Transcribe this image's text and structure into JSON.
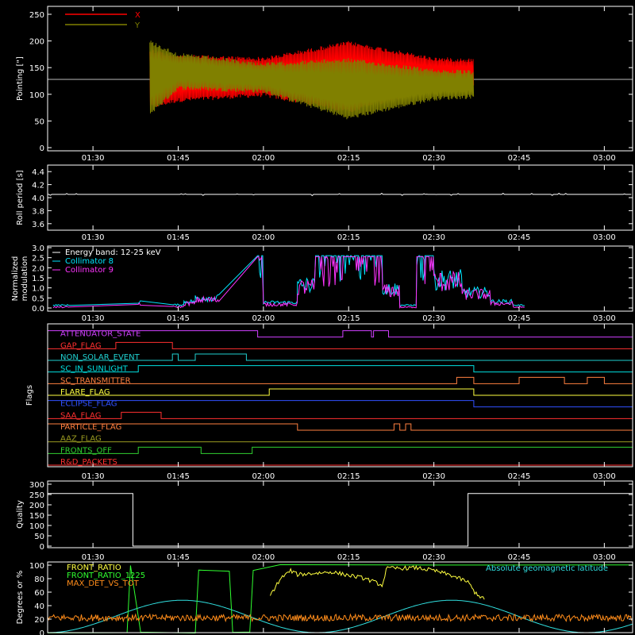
{
  "chart_data": [
    {
      "id": "pointing",
      "type": "line",
      "ylabel": "Pointing [\"]",
      "ylim": [
        0,
        250
      ],
      "yticks": [
        "0",
        "50",
        "100",
        "150",
        "200",
        "250"
      ],
      "reference_line": 128,
      "series": [
        {
          "name": "X",
          "color": "#ff0000",
          "envelope": [
            [
              1.667,
              72,
              185
            ],
            [
              1.75,
              85,
              175
            ],
            [
              2.0,
              95,
              170
            ],
            [
              2.25,
              65,
              200
            ],
            [
              2.5,
              108,
              170
            ],
            [
              2.617,
              112,
              168
            ]
          ]
        },
        {
          "name": "Y",
          "color": "#808000",
          "envelope": [
            [
              1.667,
              60,
              202
            ],
            [
              1.75,
              108,
              178
            ],
            [
              2.0,
              102,
              160
            ],
            [
              2.25,
              52,
              168
            ],
            [
              2.5,
              88,
              148
            ],
            [
              2.617,
              92,
              145
            ]
          ]
        }
      ]
    },
    {
      "id": "roll",
      "type": "line",
      "ylabel": "Roll period [s]",
      "ylim": [
        3.5,
        4.5
      ],
      "yticks": [
        "3.6",
        "3.8",
        "4.0",
        "4.2",
        "4.4"
      ],
      "series": [
        {
          "name": "",
          "color": "#ffffff",
          "value": 4.05,
          "x": [
            1.367,
            3.083
          ]
        }
      ]
    },
    {
      "id": "modulation",
      "type": "line",
      "ylabel_lines": [
        "Normalized",
        "modulation"
      ],
      "ylim": [
        0,
        3
      ],
      "yticks": [
        "0.0",
        "0.5",
        "1.0",
        "1.5",
        "2.0",
        "2.5",
        "3.0"
      ],
      "legend": [
        "Energy band: 12-25 keV",
        "Collimator 8",
        "Collimator 9"
      ],
      "series": [
        {
          "name": "Collimator 8",
          "color": "#00e5ff"
        },
        {
          "name": "Collimator 9",
          "color": "#ff33ff"
        }
      ],
      "segments": [
        [
          1.383,
          1.433,
          0.1
        ],
        [
          1.633,
          1.64,
          0.3
        ],
        [
          1.733,
          1.767,
          0.12
        ],
        [
          1.767,
          1.8,
          0.3
        ],
        [
          1.8,
          1.87,
          0.5
        ],
        [
          1.983,
          2.0,
          2.6
        ],
        [
          2.0,
          2.1,
          0.25
        ],
        [
          2.1,
          2.15,
          1.2
        ],
        [
          2.15,
          2.35,
          2.6
        ],
        [
          2.35,
          2.4,
          1.0
        ],
        [
          2.4,
          2.45,
          0.1
        ],
        [
          2.45,
          2.5,
          2.6
        ],
        [
          2.5,
          2.583,
          1.5
        ],
        [
          2.583,
          2.667,
          0.8
        ],
        [
          2.667,
          2.733,
          0.3
        ],
        [
          2.733,
          2.767,
          0.1
        ]
      ]
    },
    {
      "id": "flags",
      "type": "table",
      "ylabel": "Flags",
      "rows": [
        {
          "label": "ATTENUATOR_STATE",
          "color": "#d040ff",
          "transitions": [
            [
              1.367,
              1
            ],
            [
              1.983,
              0
            ],
            [
              2.233,
              1
            ],
            [
              2.317,
              0
            ],
            [
              2.323,
              1
            ],
            [
              2.367,
              0
            ],
            [
              3.083,
              0
            ]
          ]
        },
        {
          "label": "GAP_FLAG",
          "color": "#ff3030",
          "transitions": [
            [
              1.367,
              0
            ],
            [
              1.567,
              1
            ],
            [
              1.733,
              0
            ],
            [
              3.083,
              0
            ]
          ]
        },
        {
          "label": "NON_SOLAR_EVENT",
          "color": "#20d0d0",
          "transitions": [
            [
              1.367,
              0
            ],
            [
              1.733,
              1
            ],
            [
              1.75,
              0
            ],
            [
              1.8,
              1
            ],
            [
              1.95,
              0
            ],
            [
              3.083,
              0
            ]
          ]
        },
        {
          "label": "SC_IN_SUNLIGHT",
          "color": "#00e0e0",
          "transitions": [
            [
              1.367,
              0
            ],
            [
              1.633,
              1
            ],
            [
              2.617,
              0
            ],
            [
              3.083,
              0
            ]
          ]
        },
        {
          "label": "SC_TRANSMITTER",
          "color": "#ff8040",
          "transitions": [
            [
              1.367,
              0
            ],
            [
              2.567,
              1
            ],
            [
              2.617,
              0
            ],
            [
              2.75,
              1
            ],
            [
              2.883,
              0
            ],
            [
              2.95,
              1
            ],
            [
              3.0,
              0
            ],
            [
              3.083,
              0
            ]
          ]
        },
        {
          "label": "FLARE_FLAG",
          "color": "#ffff40",
          "transitions": [
            [
              1.367,
              0
            ],
            [
              2.017,
              1
            ],
            [
              2.617,
              0
            ],
            [
              3.083,
              0
            ]
          ]
        },
        {
          "label": "ECLIPSE_FLAG",
          "color": "#3050ff",
          "transitions": [
            [
              1.367,
              1
            ],
            [
              2.617,
              0
            ],
            [
              3.083,
              0
            ]
          ]
        },
        {
          "label": "SAA_FLAG",
          "color": "#ff3030",
          "transitions": [
            [
              1.367,
              0
            ],
            [
              1.583,
              1
            ],
            [
              1.7,
              0
            ],
            [
              3.083,
              0
            ]
          ]
        },
        {
          "label": "PARTICLE_FLAG",
          "color": "#ff8040",
          "transitions": [
            [
              1.367,
              1
            ],
            [
              2.1,
              0
            ],
            [
              2.383,
              1
            ],
            [
              2.4,
              0
            ],
            [
              2.417,
              1
            ],
            [
              2.433,
              0
            ],
            [
              3.083,
              0
            ]
          ]
        },
        {
          "label": "AAZ_FLAG",
          "color": "#9a9a20",
          "transitions": [
            [
              1.367,
              0
            ],
            [
              3.083,
              0
            ]
          ]
        },
        {
          "label": "FRONTS_OFF",
          "color": "#30d030",
          "transitions": [
            [
              1.367,
              0
            ],
            [
              1.633,
              1
            ],
            [
              1.817,
              0
            ],
            [
              1.967,
              1
            ],
            [
              3.083,
              1
            ]
          ]
        },
        {
          "label": "R&D_PACKETS",
          "color": "#ff3030",
          "transitions": [
            [
              1.367,
              0
            ],
            [
              3.083,
              0
            ]
          ]
        }
      ]
    },
    {
      "id": "quality",
      "type": "line",
      "ylabel": "Quality",
      "ylim": [
        0,
        300
      ],
      "yticks": [
        "0",
        "50",
        "100",
        "150",
        "200",
        "250",
        "300"
      ],
      "series": [
        {
          "name": "",
          "color": "#ffffff",
          "steps": [
            [
              1.367,
              255
            ],
            [
              1.617,
              0
            ],
            [
              2.6,
              255
            ],
            [
              3.083,
              255
            ]
          ]
        }
      ]
    },
    {
      "id": "ratios",
      "type": "line",
      "ylabel": "Degrees or %",
      "ylim": [
        0,
        100
      ],
      "yticks": [
        "0",
        "20",
        "40",
        "60",
        "80",
        "100"
      ],
      "annotation": "Absolute geomagnetic latitude",
      "series": [
        {
          "name": "FRONT_RATIO",
          "color": "#ffff40"
        },
        {
          "name": "FRONT_RATIO_1225",
          "color": "#30ff30"
        },
        {
          "name": "MAX_DET_VS_TOT",
          "color": "#ff8c1a"
        }
      ]
    }
  ],
  "time_axis": {
    "labels": [
      "01:30",
      "01:45",
      "02:00",
      "02:15",
      "02:30",
      "02:45",
      "03:00"
    ],
    "tick_hours": [
      1.5,
      1.75,
      2.0,
      2.25,
      2.5,
      2.75,
      3.0
    ],
    "range_hours": [
      1.367,
      3.083
    ]
  }
}
